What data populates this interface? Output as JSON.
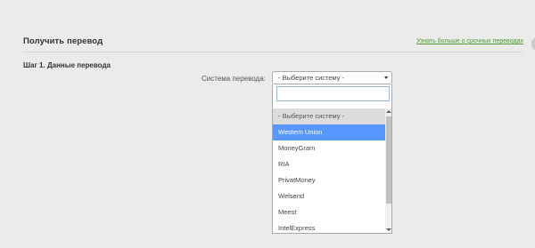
{
  "header": {
    "title": "Получить перевод",
    "learn_more_link": "Узнать больше о срочных переводах",
    "help_icon_glyph": "?"
  },
  "step": {
    "title": "Шаг 1. Данные перевода"
  },
  "transfer_system": {
    "label": "Система перевода:",
    "selected_value": "- Выберите систему -",
    "search_value": "",
    "options": [
      "- Выберите систему -",
      "Western Union",
      "MoneyGram",
      "RIA",
      "PrivatMoney",
      "Welsend",
      "Meest",
      "IntelExpress"
    ],
    "highlighted_option": "Western Union"
  },
  "colors": {
    "highlight": "#5897fb",
    "link": "#4a9a2c",
    "background": "#ebebeb"
  }
}
